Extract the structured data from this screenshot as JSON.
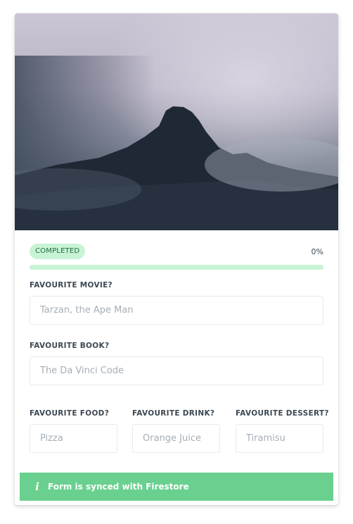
{
  "hero": {
    "alt": "Misty mountain peak"
  },
  "status": {
    "badge": "COMPLETED",
    "percent_text": "0%",
    "progress_fraction": 0
  },
  "form": {
    "movie": {
      "label": "FAVOURITE MOVIE?",
      "placeholder": "Tarzan, the Ape Man"
    },
    "book": {
      "label": "FAVOURITE BOOK?",
      "placeholder": "The Da Vinci Code"
    },
    "food": {
      "label": "FAVOURITE FOOD?",
      "placeholder": "Pizza"
    },
    "drink": {
      "label": "FAVOURITE DRINK?",
      "placeholder": "Orange Juice"
    },
    "dessert": {
      "label": "FAVOURITE DESSERT?",
      "placeholder": "Tiramisu"
    }
  },
  "notification": {
    "icon": "info-icon",
    "message": "Form is synced with Firestore"
  },
  "colors": {
    "accent": "#38c172",
    "badge_bg": "#c8f3d4",
    "toast_bg": "#6ad08f"
  }
}
